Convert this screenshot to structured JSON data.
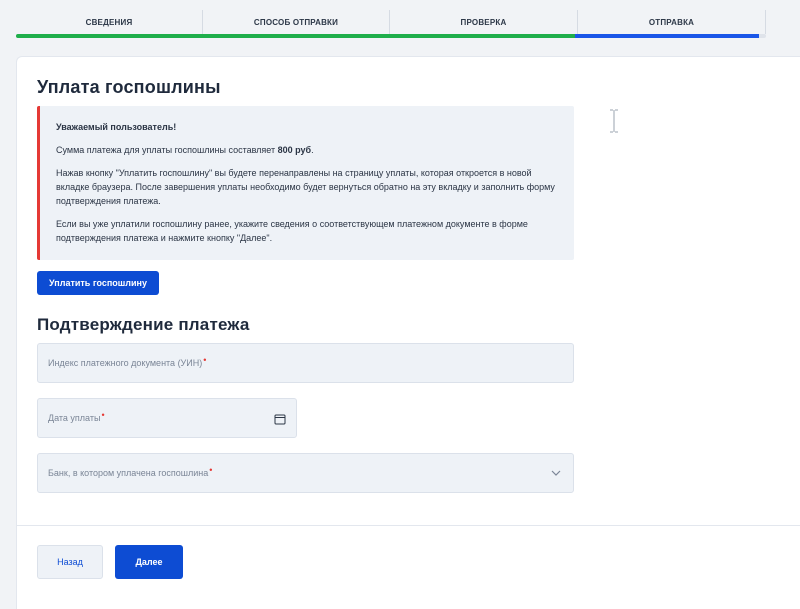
{
  "steps": {
    "items": [
      {
        "label": "Сведения"
      },
      {
        "label": "Способ отправки"
      },
      {
        "label": "Проверка"
      },
      {
        "label": "Отправка"
      }
    ],
    "progress_completed_fraction": 0.745,
    "progress_active_fraction": 0.245
  },
  "colors": {
    "accent": "#0d4cd3",
    "progress_done": "#1fae4b",
    "progress_active": "#1a56e8",
    "required_mark": "#e53935",
    "info_border": "#e53935"
  },
  "fee": {
    "title": "Уплата госпошлины",
    "notice": {
      "heading": "Уважаемый пользователь!",
      "amount_prefix": "Сумма платежа для уплаты госпошлины составляет ",
      "amount": "800 руб",
      "amount_suffix": ".",
      "paragraph2": "Нажав кнопку \"Уплатить госпошлину\" вы будете перенаправлены на страницу уплаты, которая откроется в новой вкладке браузера. После завершения уплаты необходимо будет вернуться обратно на эту вкладку и заполнить форму подтверждения платежа.",
      "paragraph3": "Если вы уже уплатили госпошлину ранее, укажите сведения о соответствующем платежном документе в форме подтверждения платежа и нажмите кнопку \"Далее\"."
    },
    "pay_button": "Уплатить госпошлину"
  },
  "confirmation": {
    "title": "Подтверждение платежа",
    "uin_placeholder": "Индекс платежного документа (УИН)",
    "date_placeholder": "Дата уплаты",
    "bank_placeholder": "Банк, в котором уплачена госпошлина",
    "required_mark": "•"
  },
  "icons": {
    "calendar": "calendar-icon",
    "chevron": "chevron-down-icon",
    "cursor": "text-cursor-icon"
  },
  "nav": {
    "back": "Назад",
    "next": "Далее"
  }
}
